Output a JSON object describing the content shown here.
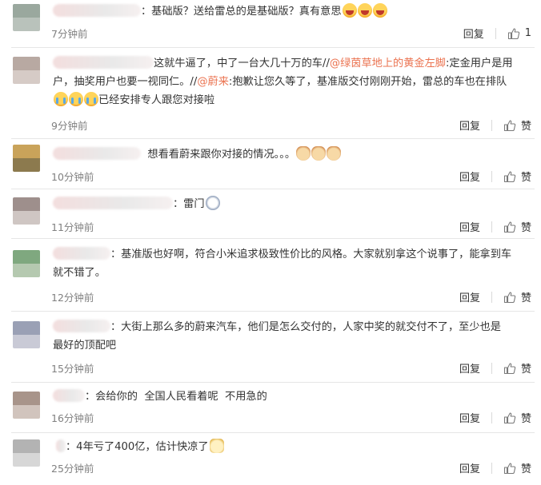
{
  "comments": [
    {
      "avatar": [
        "#9aa89e",
        "#b9c2bb"
      ],
      "name_width": 118,
      "segments": [
        {
          "type": "text",
          "text": "：基础版？送给雷总的是基础版？真有意思"
        }
      ],
      "emojis": [
        "laugh",
        "laugh",
        "laugh"
      ],
      "time": "7分钟前",
      "reply_label": "回复",
      "like_label": "1"
    },
    {
      "avatar": [
        "#b8a9a2",
        "#d6cbc6"
      ],
      "name_width": 140,
      "line1_a": "这就牛逼了，中了一台大几十万的车//",
      "line1_mention": "@绿茵草地上的黄金左脚",
      "line1_b": ":定金用户是用",
      "line2_a": "户，抽奖用户也要一视同仁。//",
      "line2_mention": "@蔚来",
      "line2_b": ":抱歉让您久等了，基准版交付刚刚开始，雷总的车也在排队",
      "line3": "已经安排专人跟您对接啦",
      "emojis": [
        "cry",
        "cry",
        "cry"
      ],
      "time": "9分钟前",
      "reply_label": "回复",
      "like_label": "赞"
    },
    {
      "avatar": [
        "#c9a35a",
        "#8c7a4e"
      ],
      "name_width": 150,
      "segments": [
        {
          "type": "text",
          "text": "想看看蔚来跟你对接的情况。。。"
        }
      ],
      "emojis": [
        "cat",
        "cat",
        "cat"
      ],
      "time": "10分钟前",
      "reply_label": "回复",
      "like_label": "赞"
    },
    {
      "avatar": [
        "#9e8f8c",
        "#cfc6c3"
      ],
      "name_width": 150,
      "segments": [
        {
          "type": "text",
          "text": "：雷门"
        }
      ],
      "emojis": [
        "bear"
      ],
      "time": "11分钟前",
      "reply_label": "回复",
      "like_label": "赞"
    },
    {
      "avatar": [
        "#7fa87f",
        "#b5c9b0"
      ],
      "name_width": 72,
      "line1": "：基准版也好啊，符合小米追求极致性价比的风格。大家就别拿这个说事了，能拿到车",
      "line2": "就不错了。",
      "time": "12分钟前",
      "reply_label": "回复",
      "like_label": "赞"
    },
    {
      "avatar": [
        "#9aa0b5",
        "#c9cad6"
      ],
      "name_width": 72,
      "line1": "：大街上那么多的蔚来汽车，他们是怎么交付的，人家中奖的就交付不了，至少也是",
      "line2": "最好的顶配吧",
      "time": "15分钟前",
      "reply_label": "回复",
      "like_label": "赞"
    },
    {
      "avatar": [
        "#a8948a",
        "#d1c4bd"
      ],
      "name_width": 40,
      "segments": [
        {
          "type": "text",
          "text": "：会给你的  全国人民看着呢  不用急的"
        }
      ],
      "emojis": [],
      "time": "16分钟前",
      "reply_label": "回复",
      "like_label": "赞"
    },
    {
      "avatar": [
        "#b3b3b3",
        "#d7d7d7"
      ],
      "name_width": 12,
      "segments": [
        {
          "type": "text",
          "text": "：4年亏了400亿，估计快凉了"
        }
      ],
      "emojis": [
        "doge"
      ],
      "time": "25分钟前",
      "reply_label": "回复",
      "like_label": "赞"
    }
  ]
}
